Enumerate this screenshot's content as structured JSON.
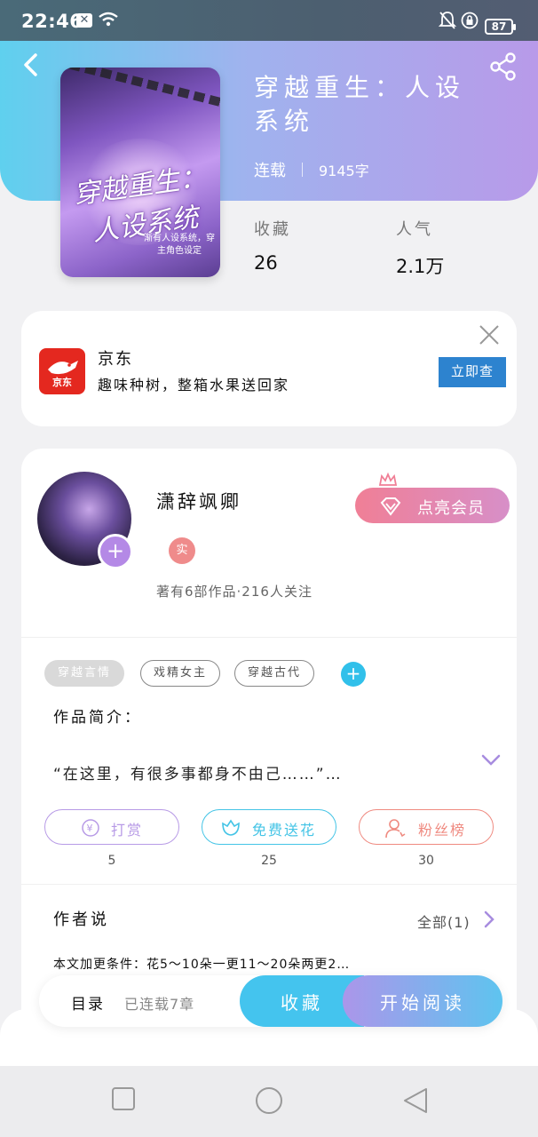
{
  "status_bar": {
    "time": "22:46",
    "battery": "87",
    "icons": [
      "notification-x-icon",
      "wifi-icon",
      "bell-off-icon",
      "lock-rotation-icon",
      "battery-icon"
    ]
  },
  "header": {
    "gradient": [
      "#5fd0ee",
      "#b89ae9"
    ],
    "back_icon": "back-arrow-icon",
    "share_icon": "share-icon"
  },
  "book": {
    "cover_title": "穿越重生：人设系统",
    "cover_sub": "渐有人设系统，穿主角色设定",
    "title": "穿越重生：人设系统",
    "status": "连载",
    "words": "9145字",
    "stats": [
      {
        "label": "收藏",
        "value": "26"
      },
      {
        "label": "人气",
        "value": "2.1万"
      }
    ]
  },
  "ad": {
    "logo_text": "京东",
    "title": "京东",
    "desc": "趣味种树，整箱水果送回家",
    "button": "立即查",
    "brand_color": "#e4281f"
  },
  "author": {
    "name": "潇辞飒卿",
    "vip_button": "点亮会员",
    "badge": "实",
    "stats": "著有6部作品·216人关注",
    "tags": [
      {
        "label": "穿越言情",
        "style": "solid"
      },
      {
        "label": "戏精女主",
        "style": "outline"
      },
      {
        "label": "穿越古代",
        "style": "outline"
      }
    ],
    "add_tag": "+"
  },
  "intro": {
    "label": "作品简介：",
    "text": "“在这里，有很多事都身不由己……”…"
  },
  "actions": [
    {
      "label": "打赏",
      "count": "5",
      "color": "#b79ae6",
      "icon": "yen-coin-icon"
    },
    {
      "label": "免费送花",
      "count": "25",
      "color": "#44c4e6",
      "icon": "flower-icon"
    },
    {
      "label": "粉丝榜",
      "count": "30",
      "color": "#ef8a80",
      "icon": "fan-ranking-icon"
    }
  ],
  "author_said": {
    "label": "作者说",
    "all": "全部(1)",
    "text": "本文加更条件：花5～10朵一更11～20朵两更2…"
  },
  "bottom_bar": {
    "toc": "目录",
    "toc_count": "已连载7章",
    "favorite": "收藏",
    "read": "开始阅读"
  },
  "nav": [
    "recent-apps-icon",
    "home-icon",
    "back-icon"
  ]
}
